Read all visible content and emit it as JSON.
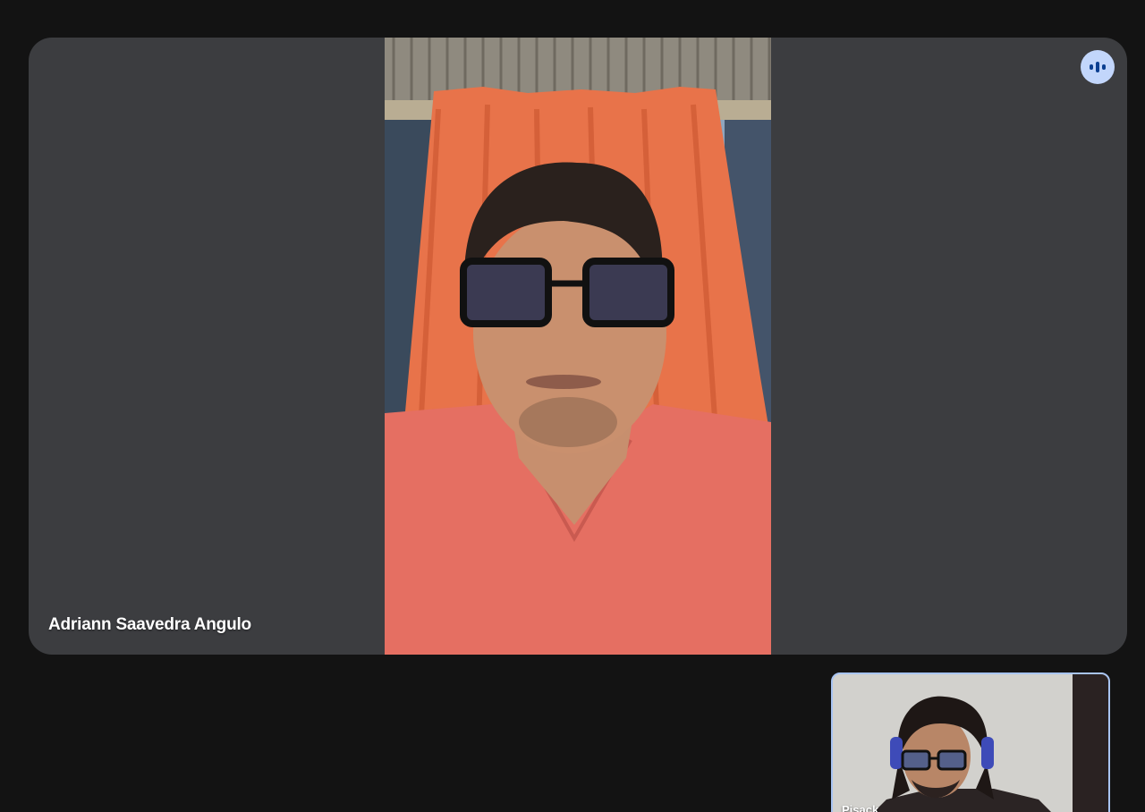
{
  "main_participant": {
    "name": "Adriann Saavedra Angulo",
    "speaking_indicator_icon": "audio-level-icon"
  },
  "self_view": {
    "name": "Pisack"
  },
  "colors": {
    "background": "#131313",
    "tile": "#3c3d40",
    "speaking_badge": "#c2d6fb",
    "self_tile_border": "#a8c4f2"
  }
}
